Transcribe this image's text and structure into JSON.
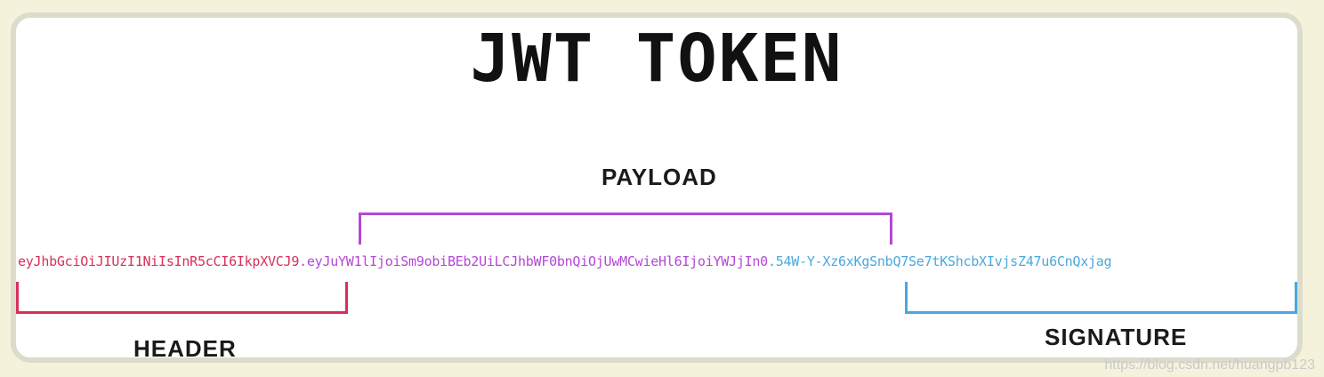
{
  "title": "JWT TOKEN",
  "token": {
    "header": "eyJhbGciOiJIUzI1NiIsInR5cCI6IkpXVCJ9",
    "dot1": ".",
    "payload": "eyJuYW1lIjoiSm9obiBEb2UiLCJhbWF0bnQiOjUwMCwieHl6IjoiYWJjIn0",
    "dot2": ".",
    "signature": "54W-Y-Xz6xKgSnbQ7Se7tKShcbXIvjsZ47u6CnQxjag"
  },
  "labels": {
    "header": "HEADER",
    "payload": "PAYLOAD",
    "signature": "SIGNATURE"
  },
  "colors": {
    "header": "#d6305a",
    "payload": "#b348d6",
    "signature": "#4aa8de"
  },
  "watermark": "https://blog.csdn.net/huangpb123"
}
